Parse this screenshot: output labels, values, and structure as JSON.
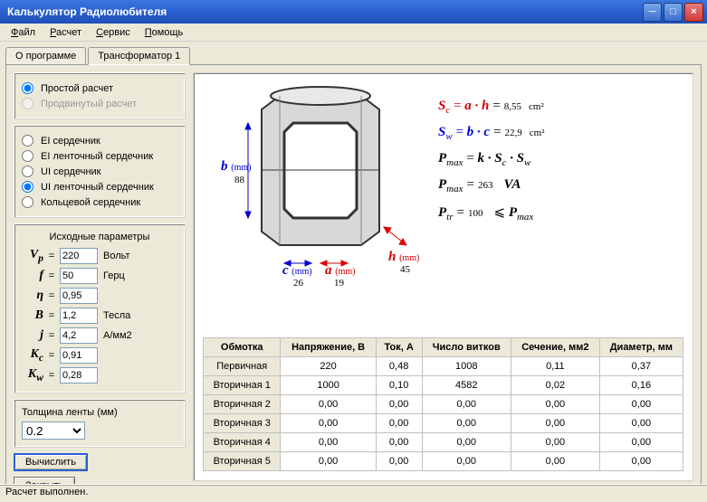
{
  "window": {
    "title": "Калькулятор Радиолюбителя"
  },
  "menu": {
    "file": "Файл",
    "calc": "Расчет",
    "service": "Сервис",
    "help": "Помощь"
  },
  "tabs": {
    "about": "О программе",
    "trans": "Трансформатор 1"
  },
  "mode": {
    "simple": "Простой расчет",
    "advanced": "Продвинутый расчет"
  },
  "cores": {
    "ei": "EI сердечник",
    "ei_tape": "EI ленточный сердечник",
    "ui": "UI сердечник",
    "ui_tape": "UI ленточный сердечник",
    "toroid": "Кольцевой сердечник"
  },
  "params_title": "Исходные параметры",
  "params": {
    "Vp": {
      "val": "220",
      "unit": "Вольт"
    },
    "f": {
      "val": "50",
      "unit": "Герц"
    },
    "eta": {
      "val": "0,95",
      "unit": ""
    },
    "B": {
      "val": "1,2",
      "unit": "Тесла"
    },
    "j": {
      "val": "4,2",
      "unit": "А/мм2"
    },
    "Kc": {
      "val": "0,91",
      "unit": ""
    },
    "Kw": {
      "val": "0,28",
      "unit": ""
    }
  },
  "tape": {
    "label": "Толщина ленты (мм)",
    "value": "0.2"
  },
  "buttons": {
    "calc": "Вычислить",
    "close": "Закрыть"
  },
  "dims": {
    "b": {
      "var": "b",
      "mm": "(mm)",
      "val": "88"
    },
    "c": {
      "var": "c",
      "mm": "(mm)",
      "val": "26"
    },
    "a": {
      "var": "a",
      "mm": "(mm)",
      "val": "19"
    },
    "h": {
      "var": "h",
      "mm": "(mm)",
      "val": "45"
    }
  },
  "formulas": {
    "sc": {
      "lhs": "Sc = a · h",
      "val": "8,55",
      "unit": "cm²"
    },
    "sw": {
      "lhs": "Sw = b · c",
      "val": "22,9",
      "unit": "cm²"
    },
    "pmax_f": "Pmax = k · Sc · Sw",
    "pmax": {
      "val": "263",
      "unit": "VA"
    },
    "ptr": {
      "val": "100",
      "rel": "≤ Pmax"
    }
  },
  "table": {
    "headers": [
      "Обмотка",
      "Напряжение, В",
      "Ток, А",
      "Число витков",
      "Сечение, мм2",
      "Диаметр, мм"
    ],
    "rows": [
      {
        "name": "Первичная",
        "v": "220",
        "i": "0,48",
        "n": "1008",
        "s": "0,11",
        "d": "0,37"
      },
      {
        "name": "Вторичная 1",
        "v": "1000",
        "i": "0,10",
        "n": "4582",
        "s": "0,02",
        "d": "0,16"
      },
      {
        "name": "Вторичная 2",
        "v": "0,00",
        "i": "0,00",
        "n": "0,00",
        "s": "0,00",
        "d": "0,00"
      },
      {
        "name": "Вторичная 3",
        "v": "0,00",
        "i": "0,00",
        "n": "0,00",
        "s": "0,00",
        "d": "0,00"
      },
      {
        "name": "Вторичная 4",
        "v": "0,00",
        "i": "0,00",
        "n": "0,00",
        "s": "0,00",
        "d": "0,00"
      },
      {
        "name": "Вторичная 5",
        "v": "0,00",
        "i": "0,00",
        "n": "0,00",
        "s": "0,00",
        "d": "0,00"
      }
    ]
  },
  "status": "Расчет выполнен."
}
